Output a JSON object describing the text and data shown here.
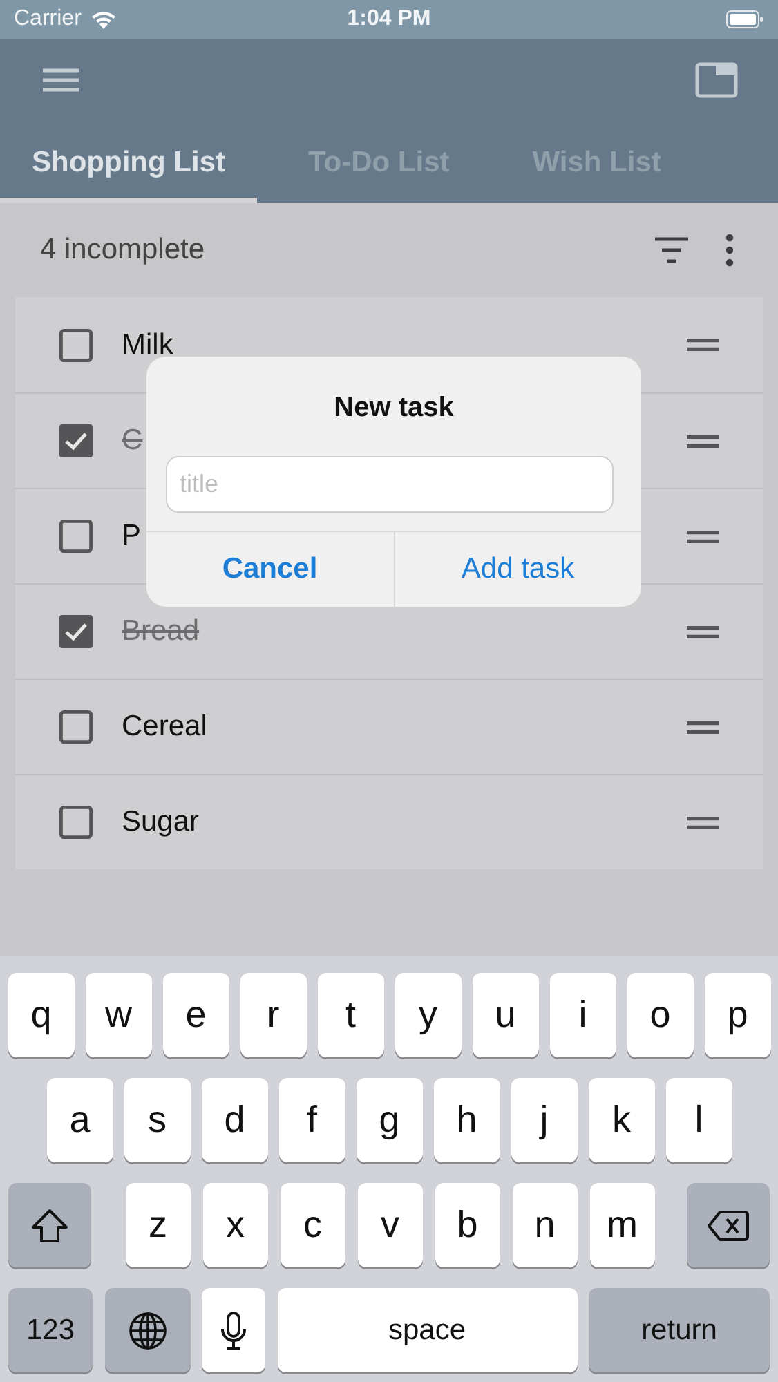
{
  "status_bar": {
    "carrier": "Carrier",
    "time": "1:04 PM"
  },
  "tabs": [
    {
      "label": "Shopping List",
      "selected": true
    },
    {
      "label": "To-Do List",
      "selected": false
    },
    {
      "label": "Wish List",
      "selected": false
    }
  ],
  "summary": "4 incomplete",
  "tasks": [
    {
      "text": "Milk",
      "checked": false
    },
    {
      "text": "C",
      "checked": true
    },
    {
      "text": "P",
      "checked": false
    },
    {
      "text": "Bread",
      "checked": true
    },
    {
      "text": "Cereal",
      "checked": false
    },
    {
      "text": "Sugar",
      "checked": false
    }
  ],
  "dialog": {
    "title": "New task",
    "placeholder": "title",
    "buttons": [
      {
        "label": "Cancel",
        "kind": "cancel"
      },
      {
        "label": "Add task",
        "kind": "default"
      }
    ]
  },
  "keyboard": {
    "rows": [
      {
        "keys": [
          {
            "kind": "letter",
            "label": "q"
          },
          {
            "kind": "letter",
            "label": "w"
          },
          {
            "kind": "letter",
            "label": "e"
          },
          {
            "kind": "letter",
            "label": "r"
          },
          {
            "kind": "letter",
            "label": "t"
          },
          {
            "kind": "letter",
            "label": "y"
          },
          {
            "kind": "letter",
            "label": "u"
          },
          {
            "kind": "letter",
            "label": "i"
          },
          {
            "kind": "letter",
            "label": "o"
          },
          {
            "kind": "letter",
            "label": "p"
          }
        ]
      },
      {
        "keys": [
          {
            "kind": "letter",
            "label": "a"
          },
          {
            "kind": "letter",
            "label": "s"
          },
          {
            "kind": "letter",
            "label": "d"
          },
          {
            "kind": "letter",
            "label": "f"
          },
          {
            "kind": "letter",
            "label": "g"
          },
          {
            "kind": "letter",
            "label": "h"
          },
          {
            "kind": "letter",
            "label": "j"
          },
          {
            "kind": "letter",
            "label": "k"
          },
          {
            "kind": "letter",
            "label": "l"
          }
        ]
      },
      {
        "keys": [
          {
            "kind": "shift"
          },
          {
            "kind": "letter",
            "label": "z"
          },
          {
            "kind": "letter",
            "label": "x"
          },
          {
            "kind": "letter",
            "label": "c"
          },
          {
            "kind": "letter",
            "label": "v"
          },
          {
            "kind": "letter",
            "label": "b"
          },
          {
            "kind": "letter",
            "label": "n"
          },
          {
            "kind": "letter",
            "label": "m"
          },
          {
            "kind": "delete"
          }
        ]
      },
      {
        "keys": [
          {
            "kind": "numbers",
            "label": "123"
          },
          {
            "kind": "globe"
          },
          {
            "kind": "mic"
          },
          {
            "kind": "space",
            "label": "space"
          },
          {
            "kind": "return",
            "label": "return"
          }
        ]
      }
    ]
  }
}
